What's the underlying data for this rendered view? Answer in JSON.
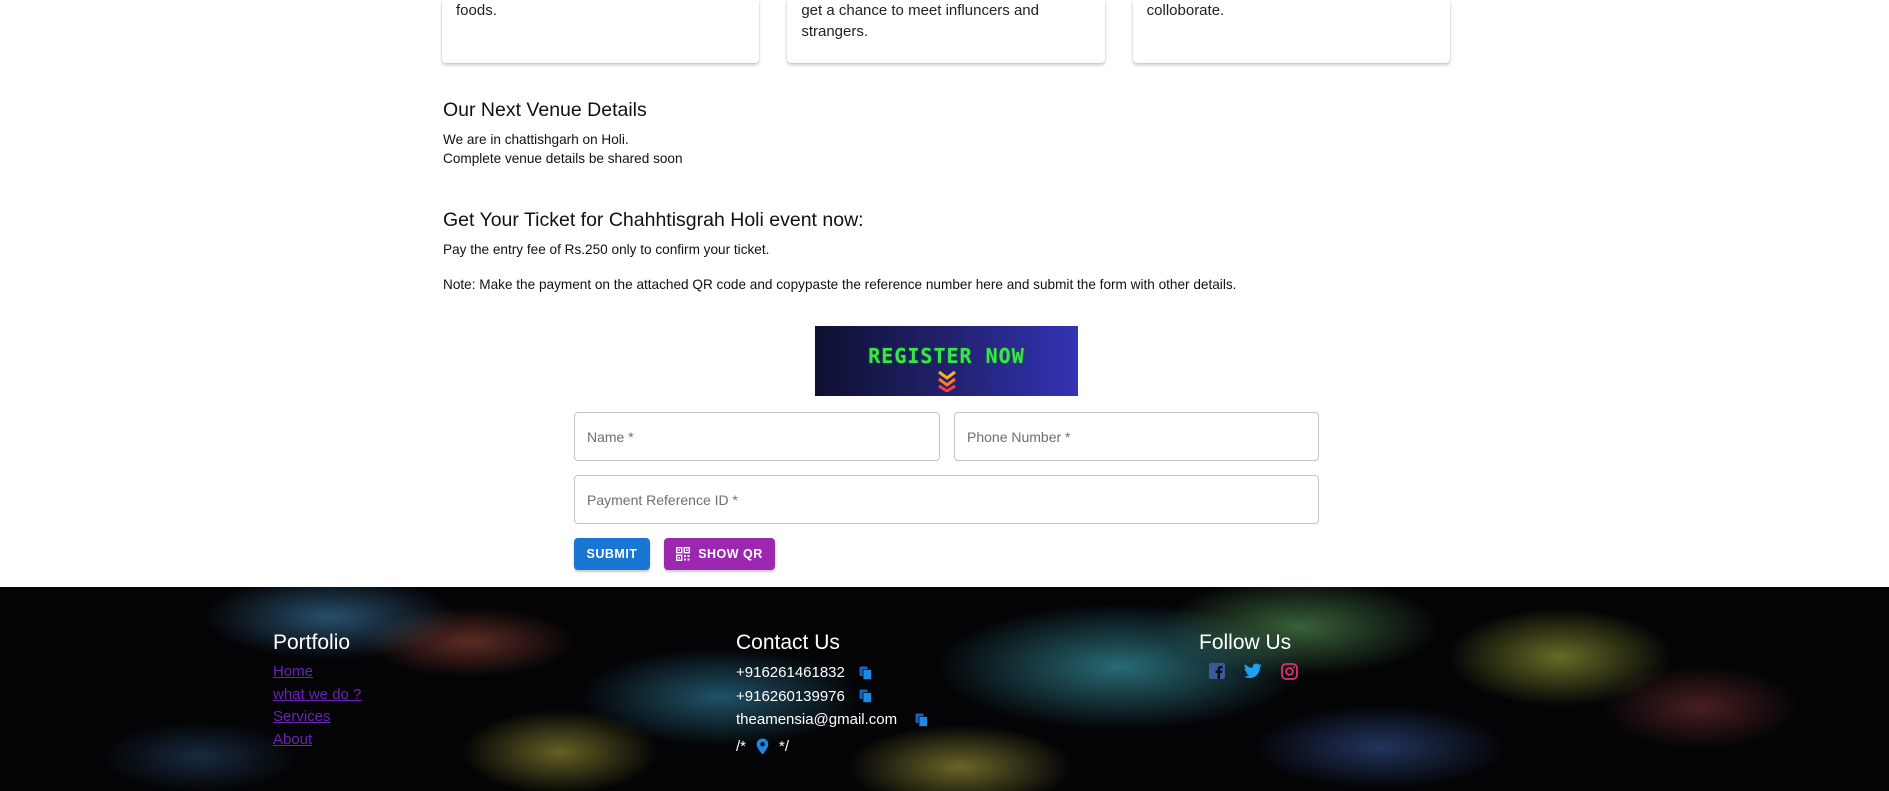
{
  "cards": [
    {
      "text": "foods."
    },
    {
      "text": "get a chance to meet influncers and strangers."
    },
    {
      "text": "colloborate."
    }
  ],
  "venue": {
    "title": "Our Next Venue Details",
    "line1": "We are in chattishgarh on Holi.",
    "line2": "Complete venue details be shared soon"
  },
  "ticket": {
    "title": "Get Your Ticket for Chahhtisgrah Holi event now:",
    "fee": "Pay the entry fee of Rs.250 only to confirm your ticket.",
    "note": "Note: Make the payment on the attached QR code and copypaste the reference number here and submit the form with other details."
  },
  "banner": {
    "text": "REGISTER NOW"
  },
  "form": {
    "name_placeholder": "Name *",
    "phone_placeholder": "Phone Number *",
    "ref_placeholder": "Payment Reference ID *",
    "submit_label": "SUBMIT",
    "qr_label": "SHOW QR"
  },
  "footer": {
    "portfolio_title": "Portfolio",
    "links": [
      "Home",
      "what we do ?",
      "Services",
      "About"
    ],
    "contact_title": "Contact Us",
    "phone1": "+916261461832",
    "phone2": "+916260139976",
    "email": "theamensia@gmail.com",
    "comment_open": "/*",
    "comment_close": "*/",
    "follow_title": "Follow Us"
  },
  "colors": {
    "primary": "#1976d2",
    "secondary": "#9c27b0",
    "link": "#6a23b5",
    "facebook": "#3b5998",
    "twitter": "#1da1f2",
    "instagram": "#e1306c"
  },
  "icons": [
    "qr-code-icon",
    "copy-icon",
    "location-pin-icon",
    "facebook-icon",
    "twitter-icon",
    "instagram-icon",
    "chevrons-down-icon"
  ]
}
